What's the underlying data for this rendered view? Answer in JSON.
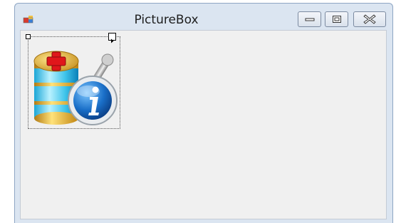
{
  "window": {
    "title": "PictureBox"
  },
  "icons": {
    "app": "app-icon",
    "minimize": "minimize-icon",
    "maximize": "maximize-icon",
    "close": "close-icon",
    "picture": "database-info-icon",
    "smart_tag": "smart-tag-arrow-icon"
  }
}
